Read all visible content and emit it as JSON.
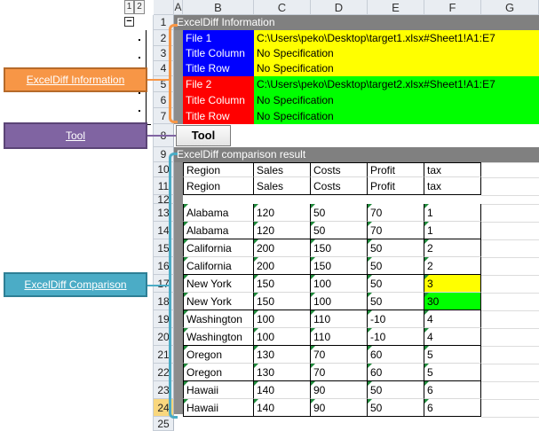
{
  "outline": {
    "levels": [
      "1",
      "2"
    ],
    "collapse": "−"
  },
  "columns": [
    "A",
    "B",
    "C",
    "D",
    "E",
    "F",
    "G"
  ],
  "rows": [
    "1",
    "2",
    "3",
    "4",
    "5",
    "6",
    "7",
    "8",
    "9",
    "10",
    "11",
    "12",
    "13",
    "14",
    "15",
    "16",
    "17",
    "18",
    "19",
    "20",
    "21",
    "22",
    "23",
    "24",
    "25"
  ],
  "info": {
    "title": "ExcelDiff Information",
    "file1": {
      "label": "File 1",
      "path": "C:\\Users\\peko\\Desktop\\target1.xlsx#Sheet1!A1:E7",
      "title_column_label": "Title Column",
      "title_column_value": "No Specification",
      "title_row_label": "Title Row",
      "title_row_value": "No Specification"
    },
    "file2": {
      "label": "File 2",
      "path": "C:\\Users\\peko\\Desktop\\target2.xlsx#Sheet1!A1:E7",
      "title_column_label": "Title Column",
      "title_column_value": "No Specification",
      "title_row_label": "Title Row",
      "title_row_value": "No Specification"
    }
  },
  "tool_button": "Tool",
  "comparison": {
    "title": "ExcelDiff comparison result",
    "rows": [
      [
        "Region",
        "Sales",
        "Costs",
        "Profit",
        "tax"
      ],
      [
        "Region",
        "Sales",
        "Costs",
        "Profit",
        "tax"
      ],
      [
        "Alabama",
        "120",
        "50",
        "70",
        "1"
      ],
      [
        "Alabama",
        "120",
        "50",
        "70",
        "1"
      ],
      [
        "California",
        "200",
        "150",
        "50",
        "2"
      ],
      [
        "California",
        "200",
        "150",
        "50",
        "2"
      ],
      [
        "New York",
        "150",
        "100",
        "50",
        "3"
      ],
      [
        "New York",
        "150",
        "100",
        "50",
        "30"
      ],
      [
        "Washington",
        "100",
        "110",
        "-10",
        "4"
      ],
      [
        "Washington",
        "100",
        "110",
        "-10",
        "4"
      ],
      [
        "Oregon",
        "130",
        "70",
        "60",
        "5"
      ],
      [
        "Oregon",
        "130",
        "70",
        "60",
        "5"
      ],
      [
        "Hawaii",
        "140",
        "90",
        "50",
        "6"
      ],
      [
        "Hawaii",
        "140",
        "90",
        "50",
        "6"
      ]
    ]
  },
  "callouts": {
    "information": "ExcelDiff Information",
    "tool": "Tool",
    "comparison": "ExcelDiff Comparison"
  },
  "colors": {
    "file1": "#0000ff",
    "file2": "#ff0000",
    "yellow": "#ffff00",
    "green": "#00ff00",
    "header_bar": "#808080",
    "orange": "#f79646",
    "purple": "#8064a2",
    "teal": "#4bacc6"
  }
}
